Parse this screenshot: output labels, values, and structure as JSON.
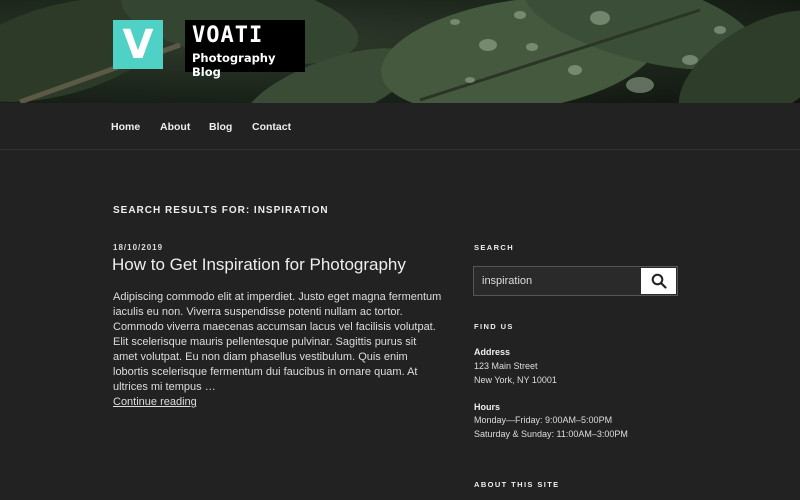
{
  "header": {
    "logo_letter": "V",
    "site_title": "VOATI",
    "site_description": "Photography Blog"
  },
  "nav": {
    "items": [
      {
        "label": "Home"
      },
      {
        "label": "About"
      },
      {
        "label": "Blog"
      },
      {
        "label": "Contact"
      }
    ]
  },
  "main": {
    "search_heading": "SEARCH RESULTS FOR: INSPIRATION",
    "post": {
      "date": "18/10/2019",
      "title": "How to Get Inspiration for Photography",
      "excerpt": "Adipiscing commodo elit at imperdiet. Justo eget magna fermentum iaculis eu non. Viverra suspendisse potenti nullam ac tortor. Commodo viverra maecenas accumsan lacus vel facilisis volutpat. Elit scelerisque mauris pellentesque pulvinar. Sagittis purus sit amet volutpat. Eu non diam phasellus vestibulum. Quis enim lobortis scelerisque fermentum dui faucibus in ornare quam. At ultrices mi tempus …",
      "read_more": "Continue reading"
    }
  },
  "sidebar": {
    "search_title": "SEARCH",
    "search_value": "inspiration",
    "search_icon": "search-icon",
    "find_us_title": "FIND US",
    "address_label": "Address",
    "address_line1": "123 Main Street",
    "address_line2": "New York, NY 10001",
    "hours_label": "Hours",
    "hours_line1": "Monday—Friday: 9:00AM–5:00PM",
    "hours_line2": "Saturday & Sunday: 11:00AM–3:00PM",
    "about_title": "ABOUT THIS SITE"
  },
  "colors": {
    "background": "#222222",
    "logo_accent": "#4fd1c5",
    "text": "#eeeeee"
  }
}
